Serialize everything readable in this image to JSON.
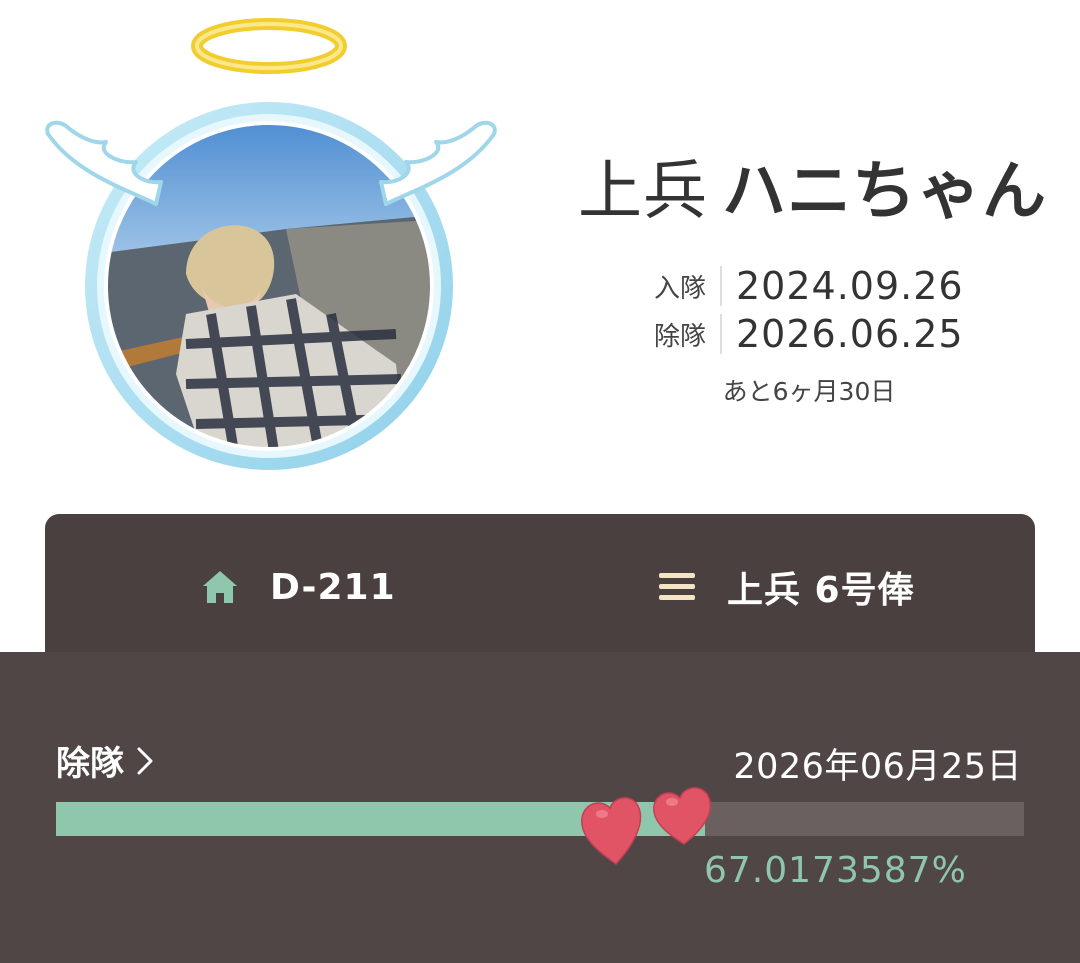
{
  "profile": {
    "rank": "上兵",
    "nickname": "ハニちゃん",
    "avatar_icon": "angel-photo-frame-icon",
    "enlist_label": "入隊",
    "enlist_date": "2024.09.26",
    "discharge_label": "除隊",
    "discharge_date": "2026.06.25",
    "remaining": "あと6ヶ月30日"
  },
  "info": {
    "unit_icon": "home-icon",
    "unit": "D-211",
    "pay_icon": "menu-lines-icon",
    "pay": "上兵 6号俸"
  },
  "discharge_progress": {
    "label": "除隊",
    "date": "2026年06月25日",
    "percent_text": "67.0173587%",
    "fraction": 0.670173587,
    "marker_icon": "hearts-icon"
  },
  "colors": {
    "accent_green": "#8fc7ac",
    "card_bg": "#4a4040",
    "panel_bg": "#514646",
    "heart": "#e05466",
    "halo": "#f5d84a",
    "frame": "#a7dcef"
  }
}
